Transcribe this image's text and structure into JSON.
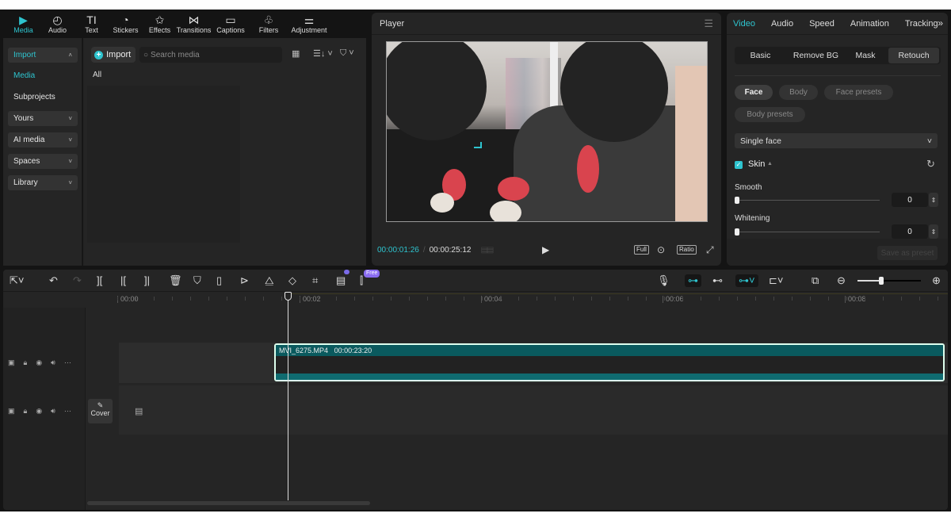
{
  "top_tabs": [
    {
      "label": "Media",
      "icon": "media-icon",
      "glyph": "▶",
      "active": true
    },
    {
      "label": "Audio",
      "icon": "audio-icon",
      "glyph": "◴"
    },
    {
      "label": "Text",
      "icon": "text-icon",
      "glyph": "TI"
    },
    {
      "label": "Stickers",
      "icon": "stickers-icon",
      "glyph": "◔"
    },
    {
      "label": "Effects",
      "icon": "effects-icon",
      "glyph": "✩"
    },
    {
      "label": "Transitions",
      "icon": "transitions-icon",
      "glyph": "⋈"
    },
    {
      "label": "Captions",
      "icon": "captions-icon",
      "glyph": "▭"
    },
    {
      "label": "Filters",
      "icon": "filters-icon",
      "glyph": "♧"
    },
    {
      "label": "Adjustment",
      "icon": "adjustment-icon",
      "glyph": "⚌"
    }
  ],
  "sidebar": {
    "import": {
      "label": "Import",
      "chevron": "˄"
    },
    "media": "Media",
    "subprojects": "Subprojects",
    "groups": [
      {
        "label": "Yours",
        "chevron": "˅"
      },
      {
        "label": "AI media",
        "chevron": "˅"
      },
      {
        "label": "Spaces",
        "chevron": "˅"
      },
      {
        "label": "Library",
        "chevron": "˅"
      }
    ]
  },
  "media": {
    "import_label": "Import",
    "search_placeholder": "Search media",
    "search_value": "",
    "filter_label": "All",
    "view_icon": "▦",
    "sort_icon": "☰↓ ˅",
    "filter_icon": "⛉ ˅"
  },
  "player": {
    "title": "Player",
    "menu_icon": "☰",
    "current_time": "00:00:01:26",
    "separator": "/",
    "total_time": "00:00:25:12",
    "play_icon": "▶",
    "full_label": "Full",
    "ratio_label": "Ratio",
    "zoom_icon": "⊙",
    "fullscreen_icon": "⤢"
  },
  "inspector": {
    "tabs": [
      "Video",
      "Audio",
      "Speed",
      "Animation",
      "Tracking"
    ],
    "active_tab": "Video",
    "more_icon": "»",
    "subtabs": [
      "Basic",
      "Remove BG",
      "Mask",
      "Retouch"
    ],
    "active_subtab": "Retouch",
    "chips": [
      {
        "label": "Face",
        "active": true
      },
      {
        "label": "Body"
      },
      {
        "label": "Face presets"
      },
      {
        "label": "Body presets"
      }
    ],
    "face_select": "Single face",
    "select_chevron": "˅",
    "skin_checked": true,
    "skin_label": "Skin",
    "reset_icon": "↻",
    "sliders": [
      {
        "label": "Smooth",
        "value": "0",
        "fraction": 0
      },
      {
        "label": "Whitening",
        "value": "0",
        "fraction": 0
      }
    ],
    "save_preset": "Save as preset"
  },
  "timeline": {
    "free_badge": "Free",
    "ruler": [
      "00:00",
      "00:02",
      "00:04",
      "00:06",
      "00:08"
    ],
    "zoom_fraction": 0.38,
    "tracks": [
      {
        "clip_name": "MVI_6275.MP4",
        "clip_duration": "00:00:23:20"
      }
    ],
    "cover_label": "Cover",
    "cover_icon": "✎",
    "film_icon": "▤"
  },
  "accent": "#2ec4cf"
}
